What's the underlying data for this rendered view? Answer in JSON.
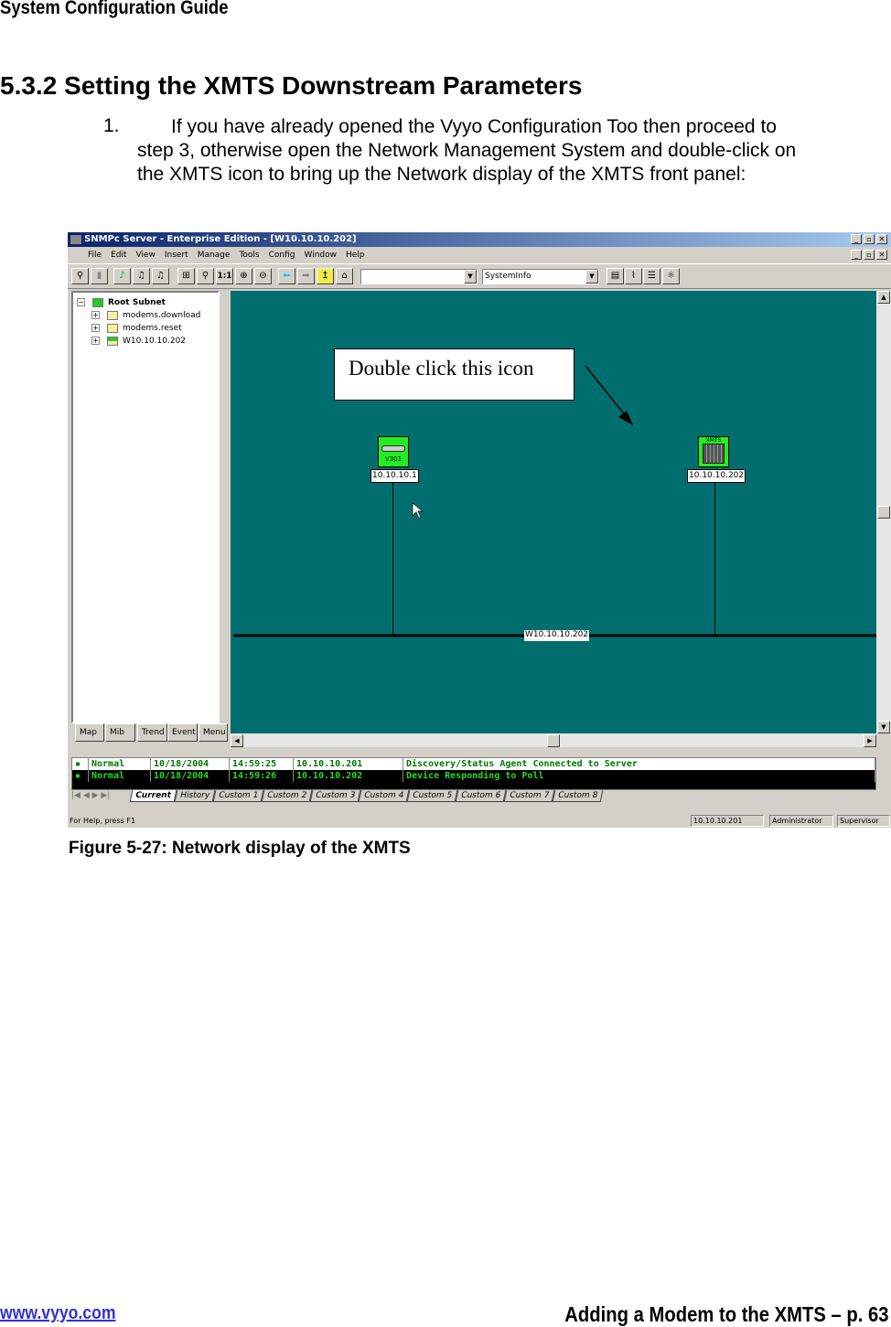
{
  "header": "System Configuration Guide",
  "section_title": "5.3.2 Setting the XMTS Downstream Parameters",
  "step_number": "1.",
  "step_text": "If you have already opened the Vyyo Configuration Too then proceed to step 3, otherwise open the Network Management System  and double-click on the XMTS icon to bring up the Network display of the XMTS front panel:",
  "app": {
    "title": "SNMPc Server - Enterprise Edition - [W10.10.10.202]",
    "menu": [
      "File",
      "Edit",
      "View",
      "Insert",
      "Manage",
      "Tools",
      "Config",
      "Window",
      "Help"
    ],
    "toolbar": {
      "combo1": "",
      "combo2": "SystemInfo"
    },
    "tree": {
      "root": "Root Subnet",
      "items": [
        "modems.download",
        "modems.reset",
        "W10.10.10.202"
      ]
    },
    "left_tabs": [
      "Map",
      "Mib",
      "Trend",
      "Event",
      "Menu"
    ],
    "map": {
      "callout": "Double click this icon",
      "nodes": [
        {
          "icon_text": "V301",
          "label": "10.10.10.1"
        },
        {
          "icon_text": "XMTS",
          "label": "10.10.10.202"
        }
      ],
      "network_label": "W10.10.10.202"
    },
    "log": {
      "rows": [
        {
          "status": "Normal",
          "date": "10/18/2004",
          "time": "14:59:25",
          "address": "10.10.10.201",
          "message": "Discovery/Status Agent Connected to Server"
        },
        {
          "status": "Normal",
          "date": "10/18/2004",
          "time": "14:59:26",
          "address": "10.10.10.202",
          "message": "Device Responding to Poll"
        }
      ],
      "tabs": [
        "Current",
        "History",
        "Custom 1",
        "Custom 2",
        "Custom 3",
        "Custom 4",
        "Custom 5",
        "Custom 6",
        "Custom 7",
        "Custom 8"
      ]
    },
    "status": {
      "help": "For Help, press F1",
      "address": "10.10.10.201",
      "user": "Administrator",
      "role": "Supervisor"
    },
    "colors": {
      "map_bg": "#006e6e",
      "node": "#22ee22",
      "log_text": "#22dd22"
    }
  },
  "caption": "Figure 5-27: Network display of the XMTS",
  "footer": {
    "link": "www.vyyo.com",
    "page": "Adding a Modem to the XMTS – p. 63"
  }
}
